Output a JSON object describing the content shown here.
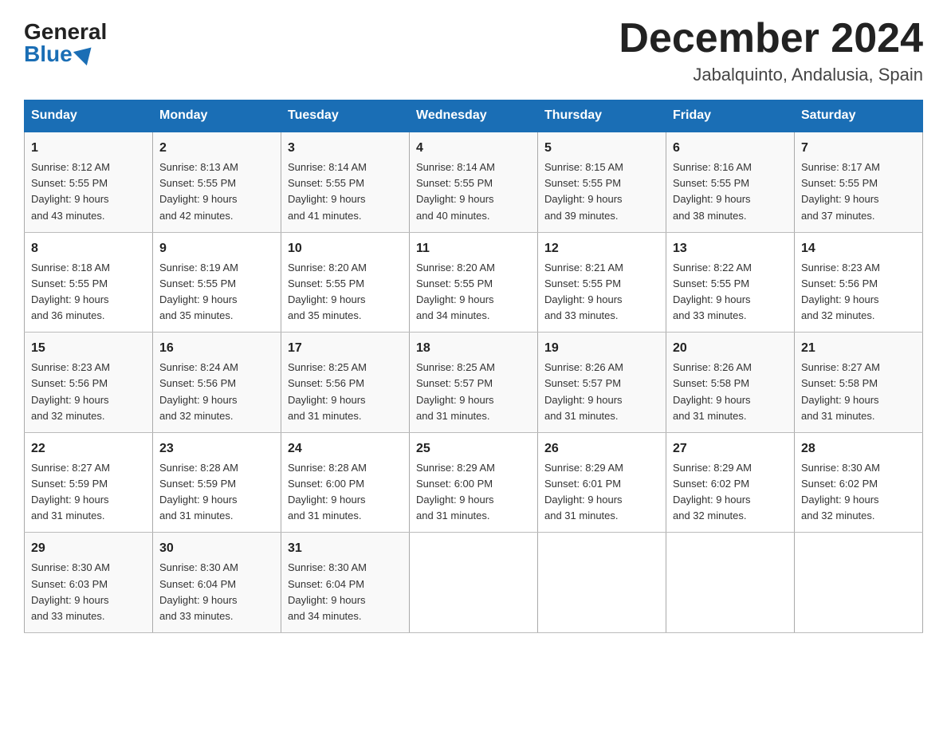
{
  "logo": {
    "general": "General",
    "blue": "Blue"
  },
  "title": "December 2024",
  "location": "Jabalquinto, Andalusia, Spain",
  "days_of_week": [
    "Sunday",
    "Monday",
    "Tuesday",
    "Wednesday",
    "Thursday",
    "Friday",
    "Saturday"
  ],
  "weeks": [
    [
      {
        "num": "1",
        "sunrise": "8:12 AM",
        "sunset": "5:55 PM",
        "daylight": "9 hours and 43 minutes."
      },
      {
        "num": "2",
        "sunrise": "8:13 AM",
        "sunset": "5:55 PM",
        "daylight": "9 hours and 42 minutes."
      },
      {
        "num": "3",
        "sunrise": "8:14 AM",
        "sunset": "5:55 PM",
        "daylight": "9 hours and 41 minutes."
      },
      {
        "num": "4",
        "sunrise": "8:14 AM",
        "sunset": "5:55 PM",
        "daylight": "9 hours and 40 minutes."
      },
      {
        "num": "5",
        "sunrise": "8:15 AM",
        "sunset": "5:55 PM",
        "daylight": "9 hours and 39 minutes."
      },
      {
        "num": "6",
        "sunrise": "8:16 AM",
        "sunset": "5:55 PM",
        "daylight": "9 hours and 38 minutes."
      },
      {
        "num": "7",
        "sunrise": "8:17 AM",
        "sunset": "5:55 PM",
        "daylight": "9 hours and 37 minutes."
      }
    ],
    [
      {
        "num": "8",
        "sunrise": "8:18 AM",
        "sunset": "5:55 PM",
        "daylight": "9 hours and 36 minutes."
      },
      {
        "num": "9",
        "sunrise": "8:19 AM",
        "sunset": "5:55 PM",
        "daylight": "9 hours and 35 minutes."
      },
      {
        "num": "10",
        "sunrise": "8:20 AM",
        "sunset": "5:55 PM",
        "daylight": "9 hours and 35 minutes."
      },
      {
        "num": "11",
        "sunrise": "8:20 AM",
        "sunset": "5:55 PM",
        "daylight": "9 hours and 34 minutes."
      },
      {
        "num": "12",
        "sunrise": "8:21 AM",
        "sunset": "5:55 PM",
        "daylight": "9 hours and 33 minutes."
      },
      {
        "num": "13",
        "sunrise": "8:22 AM",
        "sunset": "5:55 PM",
        "daylight": "9 hours and 33 minutes."
      },
      {
        "num": "14",
        "sunrise": "8:23 AM",
        "sunset": "5:56 PM",
        "daylight": "9 hours and 32 minutes."
      }
    ],
    [
      {
        "num": "15",
        "sunrise": "8:23 AM",
        "sunset": "5:56 PM",
        "daylight": "9 hours and 32 minutes."
      },
      {
        "num": "16",
        "sunrise": "8:24 AM",
        "sunset": "5:56 PM",
        "daylight": "9 hours and 32 minutes."
      },
      {
        "num": "17",
        "sunrise": "8:25 AM",
        "sunset": "5:56 PM",
        "daylight": "9 hours and 31 minutes."
      },
      {
        "num": "18",
        "sunrise": "8:25 AM",
        "sunset": "5:57 PM",
        "daylight": "9 hours and 31 minutes."
      },
      {
        "num": "19",
        "sunrise": "8:26 AM",
        "sunset": "5:57 PM",
        "daylight": "9 hours and 31 minutes."
      },
      {
        "num": "20",
        "sunrise": "8:26 AM",
        "sunset": "5:58 PM",
        "daylight": "9 hours and 31 minutes."
      },
      {
        "num": "21",
        "sunrise": "8:27 AM",
        "sunset": "5:58 PM",
        "daylight": "9 hours and 31 minutes."
      }
    ],
    [
      {
        "num": "22",
        "sunrise": "8:27 AM",
        "sunset": "5:59 PM",
        "daylight": "9 hours and 31 minutes."
      },
      {
        "num": "23",
        "sunrise": "8:28 AM",
        "sunset": "5:59 PM",
        "daylight": "9 hours and 31 minutes."
      },
      {
        "num": "24",
        "sunrise": "8:28 AM",
        "sunset": "6:00 PM",
        "daylight": "9 hours and 31 minutes."
      },
      {
        "num": "25",
        "sunrise": "8:29 AM",
        "sunset": "6:00 PM",
        "daylight": "9 hours and 31 minutes."
      },
      {
        "num": "26",
        "sunrise": "8:29 AM",
        "sunset": "6:01 PM",
        "daylight": "9 hours and 31 minutes."
      },
      {
        "num": "27",
        "sunrise": "8:29 AM",
        "sunset": "6:02 PM",
        "daylight": "9 hours and 32 minutes."
      },
      {
        "num": "28",
        "sunrise": "8:30 AM",
        "sunset": "6:02 PM",
        "daylight": "9 hours and 32 minutes."
      }
    ],
    [
      {
        "num": "29",
        "sunrise": "8:30 AM",
        "sunset": "6:03 PM",
        "daylight": "9 hours and 33 minutes."
      },
      {
        "num": "30",
        "sunrise": "8:30 AM",
        "sunset": "6:04 PM",
        "daylight": "9 hours and 33 minutes."
      },
      {
        "num": "31",
        "sunrise": "8:30 AM",
        "sunset": "6:04 PM",
        "daylight": "9 hours and 34 minutes."
      },
      null,
      null,
      null,
      null
    ]
  ],
  "labels": {
    "sunrise": "Sunrise:",
    "sunset": "Sunset:",
    "daylight": "Daylight:"
  }
}
